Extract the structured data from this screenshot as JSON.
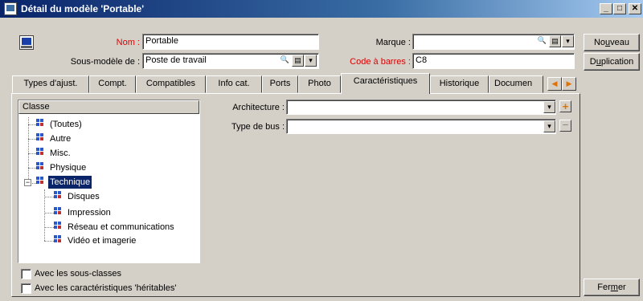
{
  "window": {
    "title": "Détail du modèle 'Portable'",
    "minimize": "_",
    "maximize": "□",
    "close": "✕"
  },
  "form": {
    "nom_label": "Nom :",
    "nom_value": "Portable",
    "sousmodele_label": "Sous-modèle de :",
    "sousmodele_value": "Poste de travail",
    "marque_label": "Marque :",
    "marque_value": "",
    "codebarres_label": "Code à barres :",
    "codebarres_value": "C8"
  },
  "buttons": {
    "nouveau_pre": "No",
    "nouveau_u": "u",
    "nouveau_post": "veau",
    "duplication_pre": "D",
    "duplication_u": "u",
    "duplication_post": "plication",
    "fermer_pre": "Fer",
    "fermer_u": "m",
    "fermer_post": "er"
  },
  "tabs": [
    {
      "label": "Types d'ajust."
    },
    {
      "label": "Compt."
    },
    {
      "label": "Compatibles"
    },
    {
      "label": "Info cat."
    },
    {
      "label": "Ports"
    },
    {
      "label": "Photo"
    },
    {
      "label": "Caractéristiques"
    },
    {
      "label": "Historique"
    },
    {
      "label": "Documen"
    }
  ],
  "tree": {
    "header": "Classe",
    "items": [
      {
        "label": "(Toutes)"
      },
      {
        "label": "Autre"
      },
      {
        "label": "Misc."
      },
      {
        "label": "Physique"
      },
      {
        "label": "Technique"
      },
      {
        "label": "Disques"
      },
      {
        "label": "Impression"
      },
      {
        "label": "Réseau et communications"
      },
      {
        "label": "Vidéo et imagerie"
      }
    ],
    "collapse_glyph": "−"
  },
  "fields": {
    "architecture_label": "Architecture :",
    "architecture_value": "",
    "typebus_label": "Type de bus :",
    "typebus_value": ""
  },
  "checkboxes": {
    "sousclasses": "Avec les sous-classes",
    "heritables": "Avec les caractéristiques 'héritables'"
  },
  "icons": {
    "search": "🔍",
    "list": "▤",
    "dropdown": "▾",
    "arrow_left": "◀",
    "arrow_right": "▶",
    "add": "+",
    "remove": "−"
  },
  "colors": {
    "titlebar": "#0a246a",
    "required_label": "#e00000",
    "selection": "#0a246a"
  }
}
